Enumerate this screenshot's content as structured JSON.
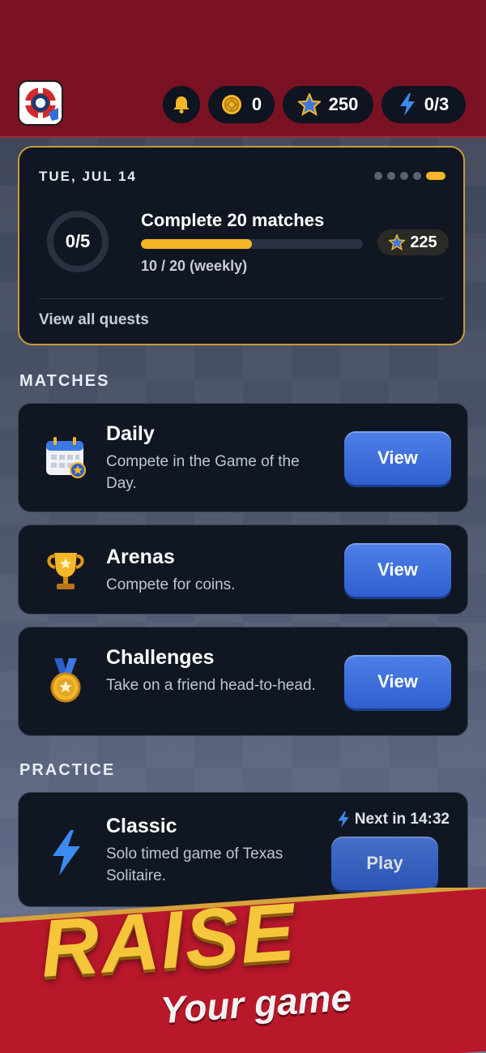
{
  "topbar": {
    "notifications": {
      "icon": "bell-icon"
    },
    "coins": {
      "icon": "coin-icon",
      "value": "0"
    },
    "stars": {
      "icon": "star-icon",
      "value": "250"
    },
    "energy": {
      "icon": "lightning-icon",
      "value": "0/3"
    }
  },
  "quest": {
    "date": "TUE, JUL 14",
    "progress_ring": "0/5",
    "title": "Complete 20 matches",
    "progress_fraction": 0.5,
    "progress_text": "10 / 20 (weekly)",
    "reward": "225",
    "link": "View all quests",
    "pager_count": 5,
    "pager_active": 4
  },
  "matches": {
    "heading": "MATCHES",
    "items": [
      {
        "icon": "calendar-icon",
        "title": "Daily",
        "desc": "Compete in the Game of the Day.",
        "button": "View"
      },
      {
        "icon": "trophy-icon",
        "title": "Arenas",
        "desc": "Compete for coins.",
        "button": "View"
      },
      {
        "icon": "medal-icon",
        "title": "Challenges",
        "desc": "Take on a friend head-to-head.",
        "button": "View"
      }
    ]
  },
  "practice": {
    "heading": "PRACTICE",
    "classic": {
      "icon": "lightning-icon",
      "title": "Classic",
      "desc": "Solo timed game of Texas Solitaire.",
      "next": "Next in 14:32",
      "button": "Play"
    }
  },
  "banner": {
    "line1": "RAISE",
    "line2": "Your game"
  },
  "colors": {
    "topbar": "#7a1224",
    "accent": "#f5b728",
    "button": "#3a6bdc",
    "card": "#111722"
  }
}
